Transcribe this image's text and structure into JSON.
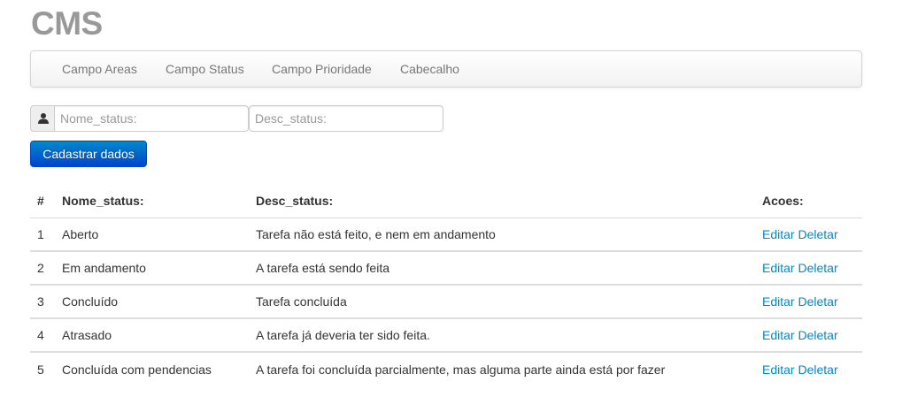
{
  "brand": "CMS",
  "nav": {
    "items": [
      {
        "label": "Campo Areas"
      },
      {
        "label": "Campo Status"
      },
      {
        "label": "Campo Prioridade"
      },
      {
        "label": "Cabecalho"
      }
    ]
  },
  "form": {
    "nome_placeholder": "Nome_status:",
    "desc_placeholder": "Desc_status:",
    "submit_label": "Cadastrar dados",
    "user_icon": "user-icon"
  },
  "table": {
    "headers": [
      "#",
      "Nome_status:",
      "Desc_status:",
      "Acoes:"
    ],
    "rows": [
      {
        "id": "1",
        "nome": "Aberto",
        "desc": "Tarefa não está feito, e nem em andamento",
        "edit": "Editar",
        "delete": "Deletar"
      },
      {
        "id": "2",
        "nome": "Em andamento",
        "desc": "A tarefa está sendo feita",
        "edit": "Editar",
        "delete": "Deletar"
      },
      {
        "id": "3",
        "nome": "Concluído",
        "desc": "Tarefa concluída",
        "edit": "Editar",
        "delete": "Deletar"
      },
      {
        "id": "4",
        "nome": "Atrasado",
        "desc": "A tarefa já deveria ter sido feita.",
        "edit": "Editar",
        "delete": "Deletar"
      },
      {
        "id": "5",
        "nome": "Concluída com pendencias",
        "desc": "A tarefa foi concluída parcialmente, mas alguma parte ainda está por fazer",
        "edit": "Editar",
        "delete": "Deletar"
      }
    ]
  },
  "colors": {
    "brand": "#999999",
    "link": "#0088cc",
    "button_primary": "#0044cc"
  }
}
